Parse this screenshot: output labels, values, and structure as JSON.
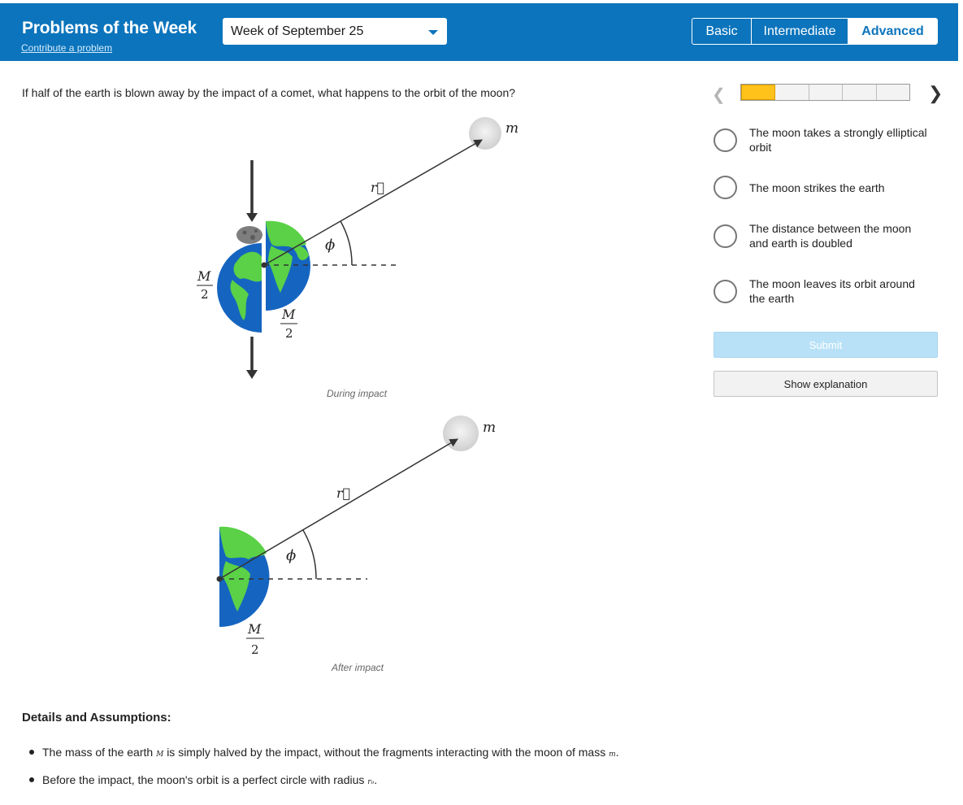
{
  "header": {
    "title": "Problems of the Week",
    "contribute_link": "Contribute a problem",
    "week_selected": "Week of September 25",
    "levels": [
      "Basic",
      "Intermediate",
      "Advanced"
    ],
    "active_level": "Advanced",
    "background_color": "#0b74bc"
  },
  "question": {
    "text": "If half of the earth is blown away by the impact of a comet, what happens to the orbit of the moon?"
  },
  "figure": {
    "during": {
      "moon_label": "m",
      "vector_label": "r⃗",
      "angle_label": "ϕ",
      "half_mass_left_num": "M",
      "half_mass_left_den": "2",
      "half_mass_right_num": "M",
      "half_mass_right_den": "2",
      "caption": "During impact"
    },
    "after": {
      "moon_label": "m",
      "vector_label": "r⃗",
      "angle_label": "ϕ",
      "half_mass_num": "M",
      "half_mass_den": "2",
      "caption": "After impact"
    }
  },
  "progress": {
    "segments": 5,
    "current": 1,
    "active_color": "#ffc21a"
  },
  "answers": [
    {
      "line1": "The moon takes a strongly elliptical",
      "line2": "orbit"
    },
    {
      "line1": "The moon strikes the earth",
      "line2": ""
    },
    {
      "line1": "The distance between the moon",
      "line2": "and earth is doubled"
    },
    {
      "line1": "The moon leaves its orbit around",
      "line2": "the earth"
    }
  ],
  "buttons": {
    "submit": "Submit",
    "show_explanation": "Show explanation"
  },
  "details": {
    "title": "Details and Assumptions:",
    "bullet1_a": "The mass of the earth",
    "bullet1_var1": "M",
    "bullet1_b": "is simply halved by the impact, without the fragments interacting with the moon of mass",
    "bullet1_var2": "m",
    "bullet1_end": ".",
    "bullet2_a": "Before the impact, the moon's orbit is a perfect circle with radius",
    "bullet2_var": "r₀",
    "bullet2_end": "."
  }
}
